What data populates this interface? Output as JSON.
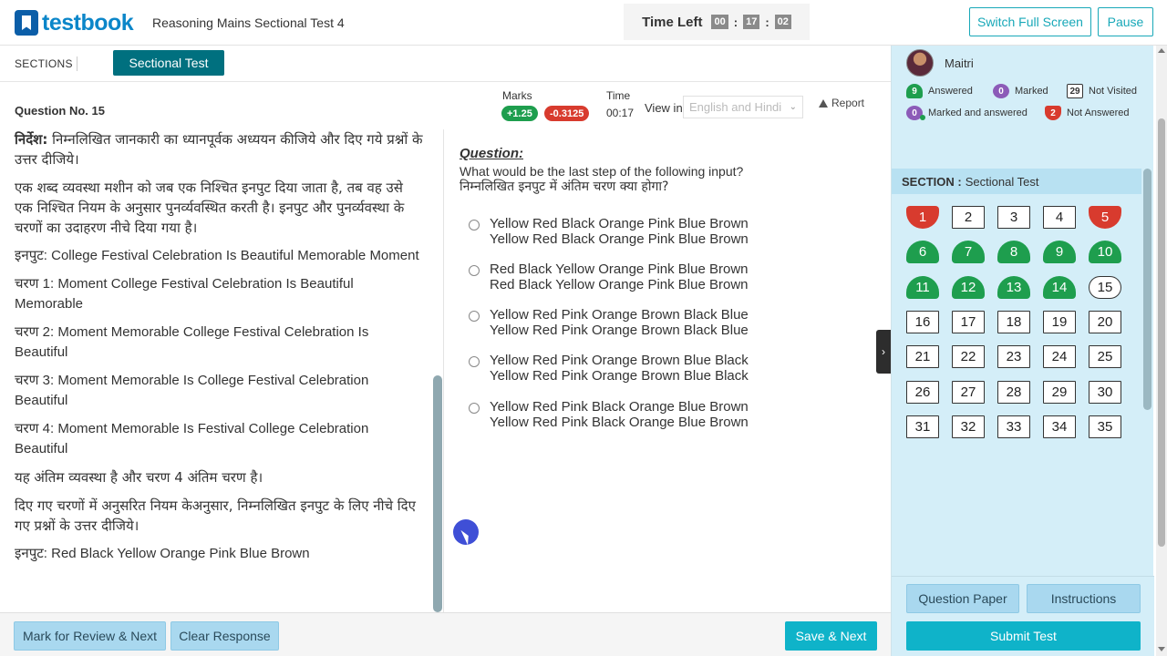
{
  "header": {
    "logo_text": "testbook",
    "test_name": "Reasoning Mains Sectional Test 4",
    "timer_label": "Time Left",
    "timer": {
      "hours": "00",
      "minutes": "17",
      "seconds": "02"
    },
    "switch_fullscreen": "Switch Full Screen",
    "pause": "Pause"
  },
  "sections": {
    "label": "SECTIONS",
    "active_tab": "Sectional Test"
  },
  "question_meta": {
    "question_no": "Question No. 15",
    "marks_label": "Marks",
    "positive": "+1.25",
    "negative": "-0.3125",
    "time_label": "Time",
    "time_value": "00:17",
    "view_in_label": "View in",
    "language": "English and Hindi",
    "report": "Report"
  },
  "passage": {
    "p1_bold": "निर्देश:",
    "p1_rest": " निम्नलिखित जानकारी का ध्यानपूर्वक अध्ययन कीजिये और दिए गये प्रश्नों के उत्तर दीजिये।",
    "p2": "एक शब्द व्यवस्था मशीन को जब एक निश्चित इनपुट दिया जाता है, तब वह उसे एक निश्चित नियम के अनुसार पुनर्व्यवस्थित करती है। इनपुट और पुनर्व्यवस्था के चरणों का उदाहरण नीचे दिया गया है।",
    "p3": "इनपुट: College Festival Celebration Is Beautiful Memorable Moment",
    "p4": "चरण 1: Moment College Festival Celebration Is Beautiful Memorable",
    "p5": "चरण 2: Moment Memorable College Festival Celebration Is Beautiful",
    "p6": "चरण 3: Moment Memorable Is College Festival Celebration Beautiful",
    "p7": "चरण 4: Moment Memorable Is Festival College Celebration Beautiful",
    "p8": "यह अंतिम व्यवस्था है और चरण 4 अंतिम चरण है।",
    "p9": "दिए गए चरणों में अनुसरित नियम केअनुसार, निम्नलिखित इनपुट के लिए नीचे दिए गए प्रश्नों के उत्तर दीजिये।",
    "p10": "इनपुट: Red Black Yellow Orange Pink Blue Brown"
  },
  "question": {
    "heading": "Question:",
    "text_en": "What would be the last step of the following input?",
    "text_hi": "निम्नलिखित इनपुट में अंतिम चरण क्या होगा?",
    "options": [
      {
        "en": "Yellow Red Black Orange Pink Blue Brown",
        "hi": "Yellow Red Black Orange Pink Blue Brown"
      },
      {
        "en": "Red Black Yellow Orange Pink Blue Brown",
        "hi": "Red Black Yellow Orange Pink Blue Brown"
      },
      {
        "en": "Yellow Red Pink Orange Brown Black Blue",
        "hi": "Yellow Red Pink Orange Brown Black Blue"
      },
      {
        "en": "Yellow Red Pink Orange Brown Blue Black",
        "hi": "Yellow Red Pink Orange Brown Blue Black"
      },
      {
        "en": "Yellow Red Pink Black Orange Blue Brown",
        "hi": "Yellow Red Pink Black Orange Blue Brown"
      }
    ]
  },
  "bottom": {
    "mark_review": "Mark for Review & Next",
    "clear": "Clear Response",
    "save_next": "Save & Next"
  },
  "panel": {
    "user_name": "Maitri",
    "legend": {
      "answered_count": "9",
      "answered_label": "Answered",
      "marked_count": "0",
      "marked_label": "Marked",
      "not_visited_count": "29",
      "not_visited_label": "Not Visited",
      "marked_answered_count": "0",
      "marked_answered_label": "Marked and answered",
      "not_answered_count": "2",
      "not_answered_label": "Not Answered"
    },
    "section_label": "SECTION :",
    "section_name": "Sectional Test",
    "palette": [
      {
        "n": "1",
        "s": "notanswered"
      },
      {
        "n": "2",
        "s": "notvisited"
      },
      {
        "n": "3",
        "s": "notvisited"
      },
      {
        "n": "4",
        "s": "notvisited"
      },
      {
        "n": "5",
        "s": "notanswered"
      },
      {
        "n": "6",
        "s": "answered"
      },
      {
        "n": "7",
        "s": "answered"
      },
      {
        "n": "8",
        "s": "answered"
      },
      {
        "n": "9",
        "s": "answered"
      },
      {
        "n": "10",
        "s": "answered"
      },
      {
        "n": "11",
        "s": "answered"
      },
      {
        "n": "12",
        "s": "answered"
      },
      {
        "n": "13",
        "s": "answered"
      },
      {
        "n": "14",
        "s": "answered"
      },
      {
        "n": "15",
        "s": "current"
      },
      {
        "n": "16",
        "s": "notvisited"
      },
      {
        "n": "17",
        "s": "notvisited"
      },
      {
        "n": "18",
        "s": "notvisited"
      },
      {
        "n": "19",
        "s": "notvisited"
      },
      {
        "n": "20",
        "s": "notvisited"
      },
      {
        "n": "21",
        "s": "notvisited"
      },
      {
        "n": "22",
        "s": "notvisited"
      },
      {
        "n": "23",
        "s": "notvisited"
      },
      {
        "n": "24",
        "s": "notvisited"
      },
      {
        "n": "25",
        "s": "notvisited"
      },
      {
        "n": "26",
        "s": "notvisited"
      },
      {
        "n": "27",
        "s": "notvisited"
      },
      {
        "n": "28",
        "s": "notvisited"
      },
      {
        "n": "29",
        "s": "notvisited"
      },
      {
        "n": "30",
        "s": "notvisited"
      },
      {
        "n": "31",
        "s": "notvisited"
      },
      {
        "n": "32",
        "s": "notvisited"
      },
      {
        "n": "33",
        "s": "notvisited"
      },
      {
        "n": "34",
        "s": "notvisited"
      },
      {
        "n": "35",
        "s": "notvisited"
      }
    ],
    "question_paper": "Question Paper",
    "instructions": "Instructions",
    "submit": "Submit Test"
  },
  "colors": {
    "accent": "#0fb3c9",
    "answered": "#1e9e4e",
    "not_answered": "#d83b2e",
    "marked": "#8c5bb8",
    "section_tab": "#00707f"
  }
}
